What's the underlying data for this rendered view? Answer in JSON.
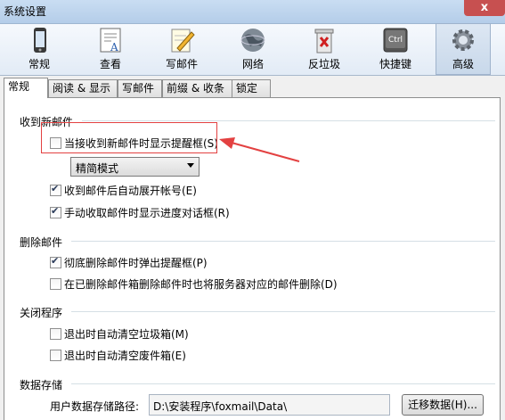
{
  "window": {
    "title": "系统设置",
    "close_glyph": "x"
  },
  "toolbar": {
    "items": [
      {
        "label": "常规",
        "icon": "phone-icon"
      },
      {
        "label": "查看",
        "icon": "book-icon"
      },
      {
        "label": "写邮件",
        "icon": "notepad-pencil-icon"
      },
      {
        "label": "网络",
        "icon": "globe-icon"
      },
      {
        "label": "反垃圾",
        "icon": "trash-icon"
      },
      {
        "label": "快捷键",
        "icon": "ctrl-key-icon",
        "key_text": "Ctrl"
      },
      {
        "label": "高级",
        "icon": "gear-icon",
        "active": true
      }
    ]
  },
  "tabs": [
    {
      "label": "常规",
      "active": true
    },
    {
      "label": "阅读 & 显示"
    },
    {
      "label": "写邮件"
    },
    {
      "label": "前缀 & 收条"
    },
    {
      "label": "锁定"
    }
  ],
  "sections": {
    "new_mail": {
      "title": "收到新邮件",
      "show_reminder": {
        "label": "当接收到新邮件时显示提醒框(S)",
        "checked": false
      },
      "mode_select": {
        "value": "精简模式"
      },
      "auto_expand": {
        "label": "收到邮件后自动展开帐号(E)",
        "checked": true
      },
      "show_progress": {
        "label": "手动收取邮件时显示进度对话框(R)",
        "checked": true
      }
    },
    "delete_mail": {
      "title": "删除邮件",
      "popup_on_delete": {
        "label": "彻底删除邮件时弹出提醒框(P)",
        "checked": true
      },
      "delete_server": {
        "label": "在已删除邮件箱删除邮件时也将服务器对应的邮件删除(D)",
        "checked": false
      }
    },
    "close_program": {
      "title": "关闭程序",
      "clear_junk": {
        "label": "退出时自动清空垃圾箱(M)",
        "checked": false
      },
      "clear_trash": {
        "label": "退出时自动清空废件箱(E)",
        "checked": false
      }
    },
    "data_storage": {
      "title": "数据存储",
      "path_label": "用户数据存储路径:",
      "path_value": "D:\\安装程序\\foxmail\\Data\\",
      "migrate_button": "迁移数据(H)..."
    }
  },
  "colors": {
    "annotation": "#e34141",
    "accent": "#2a3b5a"
  }
}
